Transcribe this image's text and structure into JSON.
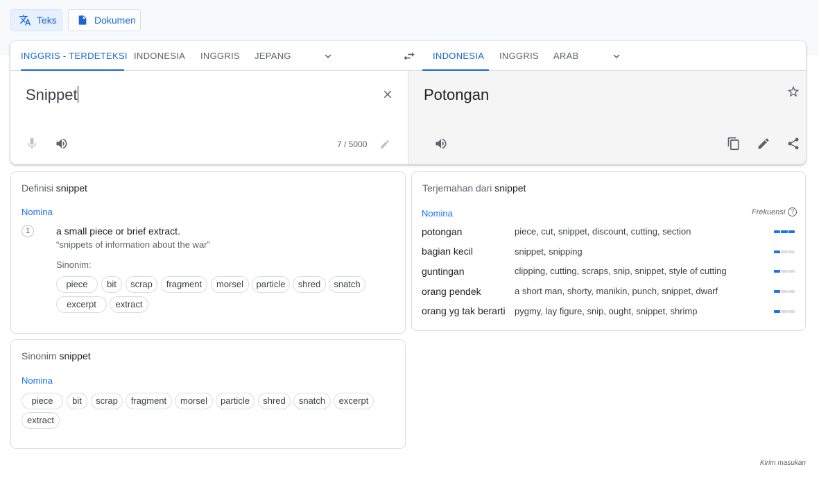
{
  "modes": {
    "text_label": "Teks",
    "document_label": "Dokumen"
  },
  "source_langs": [
    "INGGRIS - TERDETEKSI",
    "INDONESIA",
    "INGGRIS",
    "JEPANG"
  ],
  "target_langs": [
    "INDONESIA",
    "INGGRIS",
    "ARAB"
  ],
  "source": {
    "text": "Snippet",
    "counter": "7 / 5000"
  },
  "target": {
    "text": "Potongan"
  },
  "definition": {
    "title_prefix": "Definisi",
    "word": "snippet",
    "pos": "Nomina",
    "num": "1",
    "text": "a small piece or brief extract.",
    "example": "“snippets of information about the war”",
    "syn_label": "Sinonim:",
    "synonyms": [
      "piece",
      "bit",
      "scrap",
      "fragment",
      "morsel",
      "particle",
      "shred",
      "snatch",
      "excerpt",
      "extract"
    ]
  },
  "synonyms_card": {
    "title_prefix": "Sinonim",
    "word": "snippet",
    "pos": "Nomina",
    "items": [
      "piece",
      "bit",
      "scrap",
      "fragment",
      "morsel",
      "particle",
      "shred",
      "snatch",
      "excerpt",
      "extract"
    ]
  },
  "translations": {
    "title_prefix": "Terjemahan dari",
    "word": "snippet",
    "pos": "Nomina",
    "freq_label": "Frekuensi",
    "help_glyph": "?",
    "rows": [
      {
        "word": "potongan",
        "syns": "piece, cut, snippet, discount, cutting, section",
        "frequency": 3
      },
      {
        "word": "bagian kecil",
        "syns": "snippet, snipping",
        "frequency": 1
      },
      {
        "word": "guntingan",
        "syns": "clipping, cutting, scraps, snip, snippet, style of cutting",
        "frequency": 1
      },
      {
        "word": "orang pendek",
        "syns": "a short man, shorty, manikin, punch, snippet, dwarf",
        "frequency": 1
      },
      {
        "word": "orang yg tak berarti",
        "syns": "pygmy, lay figure, snip, ought, snippet, shrimp",
        "frequency": 1
      }
    ]
  },
  "feedback": "Kirim masukan",
  "colors": {
    "accent": "#1a73e8",
    "active_tab": "#1967d2",
    "target_bg": "#f5f5f5",
    "border": "#dadce0"
  },
  "icons": [
    "translate-icon",
    "document-icon",
    "chevron-down-icon",
    "swap-icon",
    "close-icon",
    "mic-icon",
    "speaker-icon",
    "pencil-icon",
    "star-icon",
    "copy-icon",
    "edit-icon",
    "share-icon",
    "help-icon"
  ]
}
